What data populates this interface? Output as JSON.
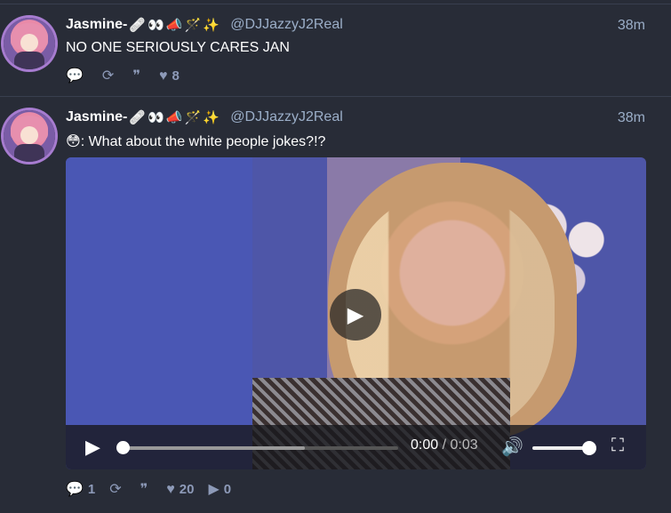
{
  "posts": [
    {
      "display_name": "Jasmine-",
      "emojis": [
        "🩹",
        "👀",
        "📣",
        "🪄",
        "✨"
      ],
      "handle": "@DJJazzyJ2Real",
      "time": "38m",
      "content": "NO ONE SERIOUSLY CARES JAN",
      "actions": {
        "reply": "",
        "boost": "",
        "quote": "",
        "favourite": "8"
      }
    },
    {
      "display_name": "Jasmine-",
      "emojis": [
        "🩹",
        "👀",
        "📣",
        "🪄",
        "✨"
      ],
      "handle": "@DJJazzyJ2Real",
      "time": "38m",
      "content_prefix": "😳",
      "content": ": What about the white people jokes?!?",
      "video": {
        "current_time": "0:00",
        "separator": "/",
        "duration": "0:03",
        "progress_fraction": 0,
        "volume_fraction": 1
      },
      "actions": {
        "reply": "1",
        "boost": "",
        "quote": "",
        "favourite": "20",
        "play": "0"
      }
    }
  ],
  "icons": {
    "reply": "speech-bubble-icon",
    "boost": "repost-icon",
    "quote": "quote-icon",
    "favourite": "heart-icon",
    "play": "play-icon",
    "volume": "volume-icon",
    "fullscreen": "fullscreen-icon"
  },
  "colors": {
    "background": "#282c37",
    "secondary_text": "#9baec8",
    "action_icon": "#8d9ab8"
  }
}
